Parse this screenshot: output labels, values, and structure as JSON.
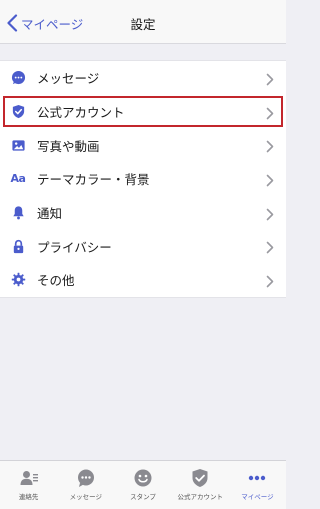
{
  "nav": {
    "back_label": "マイページ",
    "title": "設定"
  },
  "settings": {
    "items": [
      {
        "label": "メッセージ",
        "icon": "chat-bubble-icon"
      },
      {
        "label": "公式アカウント",
        "icon": "shield-check-icon",
        "highlighted": true
      },
      {
        "label": "写真や動画",
        "icon": "photo-icon"
      },
      {
        "label": "テーマカラー・背景",
        "icon": "aa-text-icon",
        "icon_text": "Aa"
      },
      {
        "label": "通知",
        "icon": "bell-icon"
      },
      {
        "label": "プライバシー",
        "icon": "lock-icon"
      },
      {
        "label": "その他",
        "icon": "gear-icon"
      }
    ]
  },
  "tabbar": {
    "tabs": [
      {
        "label": "連絡先",
        "icon": "contacts-icon"
      },
      {
        "label": "メッセージ",
        "icon": "chat-bubble-icon"
      },
      {
        "label": "スタンプ",
        "icon": "smiley-icon"
      },
      {
        "label": "公式アカウント",
        "icon": "shield-check-icon"
      },
      {
        "label": "マイページ",
        "icon": "more-dots-icon",
        "active": true
      }
    ]
  },
  "colors": {
    "accent": "#4b5ccc",
    "highlight_border": "#c3262c",
    "chevron": "#9a9aa0",
    "tab_icon": "#8a8a90"
  }
}
